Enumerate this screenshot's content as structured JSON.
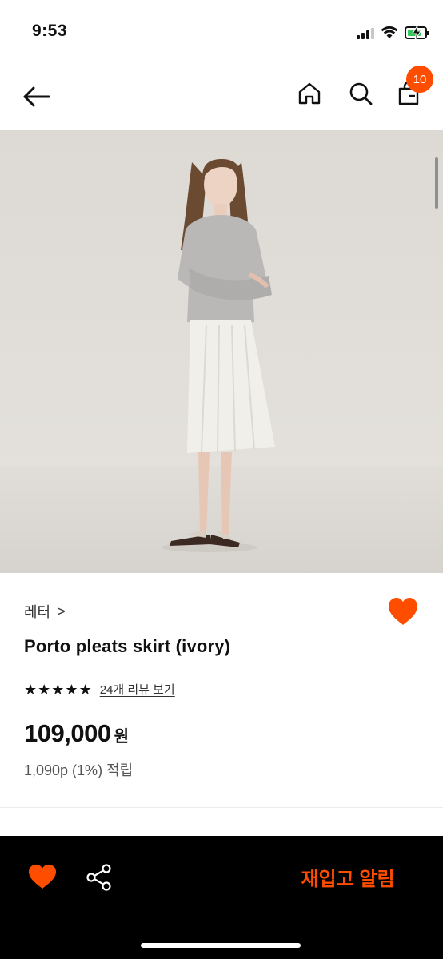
{
  "status_bar": {
    "time": "9:53"
  },
  "nav": {
    "back_icon": "arrow-left-icon",
    "home_icon": "home-icon",
    "search_icon": "search-icon",
    "cart_icon": "shopping-bag-icon",
    "cart_count": "10",
    "badge_color": "#ff4d00"
  },
  "product": {
    "image_alt": "model wearing grey sweatshirt and ivory pleated skirt",
    "brand": "레터",
    "brand_chevron": ">",
    "name": "Porto pleats skirt (ivory)",
    "rating_stars": 5,
    "review_link": "24개 리뷰 보기",
    "price": "109,000",
    "price_unit": "원",
    "points": "1,090p (1%) 적립",
    "wishlisted": true
  },
  "bottom_bar": {
    "heart_icon": "heart-icon",
    "share_icon": "share-icon",
    "restock_label": "재입고 알림"
  },
  "colors": {
    "accent": "#ff4d00",
    "bottom_bar_bg": "#000000"
  }
}
